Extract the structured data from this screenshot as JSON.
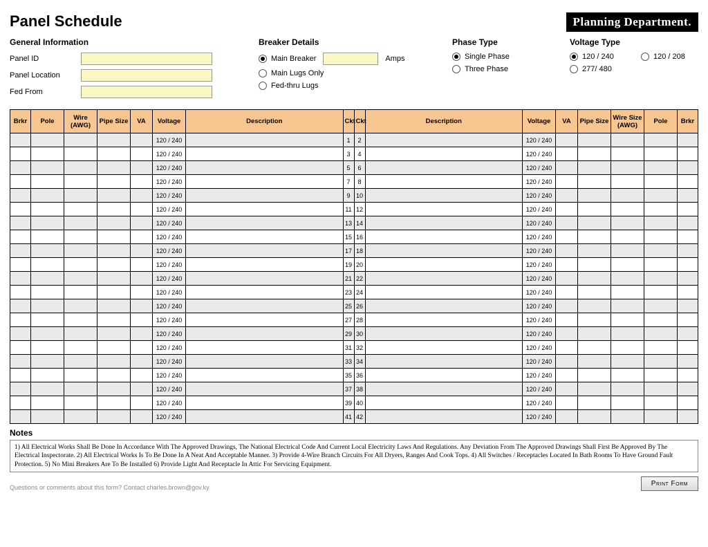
{
  "title": "Panel Schedule",
  "dept": "Planning Department.",
  "general": {
    "heading": "General Information",
    "panelIdLabel": "Panel ID",
    "panelLocationLabel": "Panel Location",
    "fedFromLabel": "Fed From"
  },
  "breaker": {
    "heading": "Breaker Details",
    "main": "Main Breaker",
    "ampsLabel": "Amps",
    "lugs": "Main Lugs Only",
    "fedThru": "Fed-thru Lugs"
  },
  "phase": {
    "heading": "Phase Type",
    "single": "Single Phase",
    "three": "Three Phase"
  },
  "voltage": {
    "heading": "Voltage Type",
    "v120_240": "120 / 240",
    "v120_208": "120 / 208",
    "v277_480": "277/ 480"
  },
  "columns": {
    "brkr": "Brkr",
    "pole": "Pole",
    "wire": "Wire (AWG)",
    "pipe": "Pipe Size",
    "va": "VA",
    "voltage": "Voltage",
    "description": "Description",
    "ckt": "Ckt",
    "pipeSize": "Pipe Size",
    "wireSize": "Wire Size (AWG)"
  },
  "rowVoltage": "120 / 240",
  "rowCount": 21,
  "notesHeading": "Notes",
  "notesText": "1) All Electrical Works Shall Be Done In Accordance With The Approved Drawings, The National Electrical Code And Current Local Electricity Laws And Regulations. Any Deviation From The Approved Drawings Shall First Be Approved By The Electrical Inspectorate. 2) All Electrical Works Is To Be Done In A Neat And Acceptable Manner. 3) Provide 4-Wire Branch Circuits For All Dryers, Ranges And Cook Tops. 4) All Switches / Receptacles Located In Bath Rooms To Have Ground Fault Protection.  5) No Mini Breakers Are To Be Installed  6) Provide Light And Receptacle In Attic For Servicing Equipment.",
  "contact": "Questions or comments about this form? Contact charles.brown@gov.ky",
  "printLabel": "Print Form"
}
